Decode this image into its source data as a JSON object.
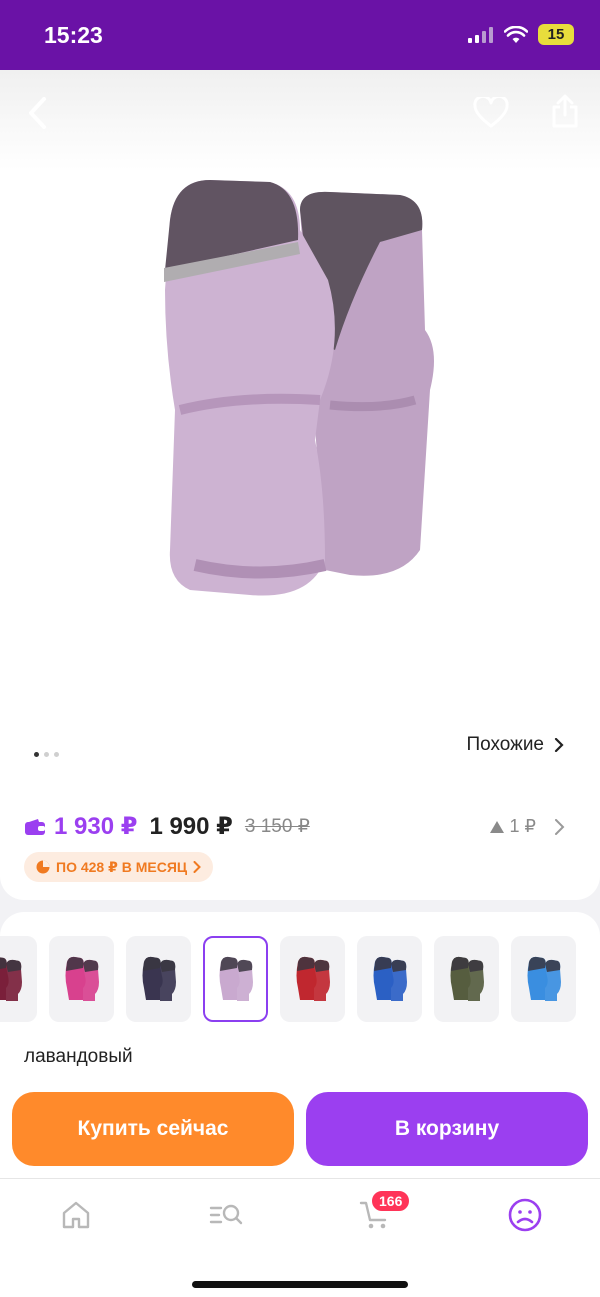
{
  "status": {
    "time": "15:23",
    "battery": "15"
  },
  "similar": {
    "label": "Похожие"
  },
  "price": {
    "wallet_price": "1 930 ₽",
    "main_price": "1 990 ₽",
    "old_price": "3 150 ₽",
    "delta": "1 ₽",
    "installment": "ПО 428 ₽ В МЕСЯЦ"
  },
  "colors": {
    "selected_name": "лавандовый",
    "swatches": [
      {
        "color": "#7a1f3a"
      },
      {
        "color": "#d8418e"
      },
      {
        "color": "#3a3550"
      },
      {
        "color": "#c9a9cf"
      },
      {
        "color": "#c0272f"
      },
      {
        "color": "#2b60c4"
      },
      {
        "color": "#565d3f"
      },
      {
        "color": "#3a8ee0"
      }
    ]
  },
  "actions": {
    "buy_now": "Купить сейчас",
    "add_to_cart": "В корзину"
  },
  "tabbar": {
    "cart_badge": "166"
  },
  "theme": {
    "purple": "#9b3ff0",
    "orange": "#ff8a2b",
    "status_bg": "#6a12a6"
  }
}
